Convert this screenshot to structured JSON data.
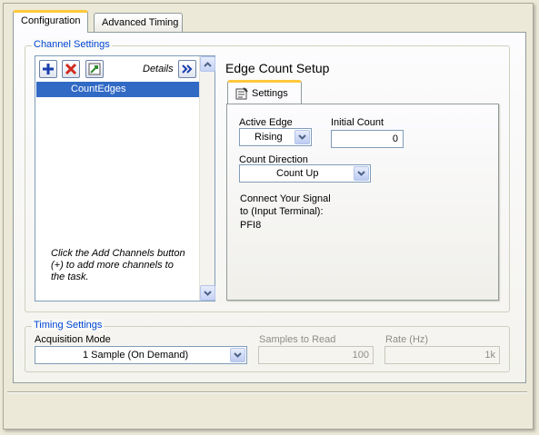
{
  "tabs": [
    "Configuration",
    "Advanced Timing"
  ],
  "channel_settings": {
    "group_title": "Channel Settings",
    "details_label": "Details",
    "channels": [
      "CountEdges"
    ],
    "hint": "Click the Add Channels button (+) to add more channels to the task.",
    "toolbar_icons": [
      "add-icon",
      "remove-icon",
      "edit-icon",
      "expand-icon"
    ]
  },
  "edge_count": {
    "title": "Edge Count Setup",
    "tab_label": "Settings",
    "active_edge_label": "Active Edge",
    "active_edge_value": "Rising",
    "initial_count_label": "Initial Count",
    "initial_count_value": "0",
    "count_direction_label": "Count Direction",
    "count_direction_value": "Count Up",
    "connect_label": "Connect Your Signal to (Input Terminal):",
    "terminal": "PFI8"
  },
  "timing": {
    "group_title": "Timing Settings",
    "acq_mode_label": "Acquisition Mode",
    "acq_mode_value": "1 Sample (On Demand)",
    "samples_label": "Samples to Read",
    "samples_value": "100",
    "rate_label": "Rate (Hz)",
    "rate_value": "1k"
  },
  "colors": {
    "accent_tab": "#ffc83c",
    "group_title": "#0046d5",
    "selection": "#316ac5"
  }
}
